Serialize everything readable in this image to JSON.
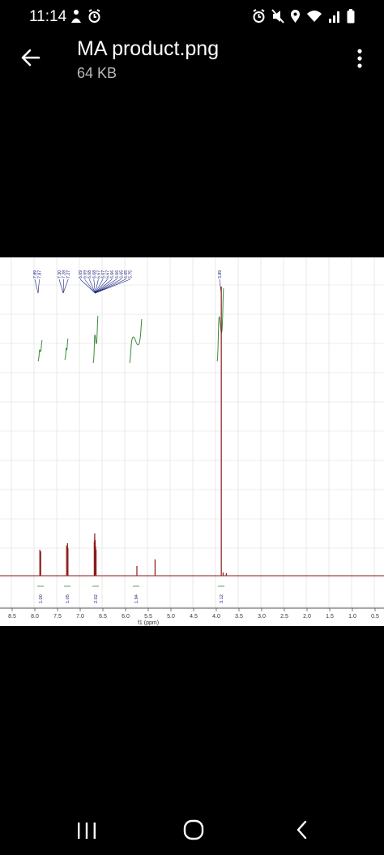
{
  "status_bar": {
    "time": "11:14",
    "left_icons": [
      "person-notification-icon",
      "alarm-icon"
    ],
    "right_icons": [
      "alarm-icon",
      "mute-icon",
      "location-icon",
      "wifi-icon",
      "signal-icon",
      "battery-icon"
    ]
  },
  "app_bar": {
    "back_icon": "arrow-back-icon",
    "file_name": "MA product.png",
    "file_size": "64 KB",
    "more_icon": "more-vert-icon"
  },
  "image": {
    "type": "1H NMR spectrum",
    "x_axis_label": "f1 (ppm)",
    "x_ticks": [
      "8.5",
      "8.0",
      "7.5",
      "7.0",
      "6.5",
      "6.0",
      "5.5",
      "5.0",
      "4.5",
      "4.0",
      "3.5",
      "3.0",
      "2.5",
      "2.0",
      "1.5",
      "1.0",
      "0.5"
    ],
    "peak_groups": [
      [
        "7.89",
        "7.87"
      ],
      [
        "7.30",
        "7.28",
        "7.27"
      ],
      [
        "6.69",
        "6.69",
        "6.68",
        "6.68",
        "6.67",
        "6.67",
        "6.67",
        "6.66",
        "6.66",
        "6.65",
        "6.65",
        "5.75"
      ],
      [
        "3.89"
      ]
    ],
    "integrals": [
      "1.00",
      "1.05",
      "2.02",
      "1.94",
      "3.12"
    ],
    "colors": {
      "spectrum": "#8b1a1a",
      "integral": "#3a8a3a",
      "peak_label": "#1a237e",
      "grid": "#dcdcdc"
    }
  },
  "nav_bar": {
    "items": [
      "recent-apps-button",
      "home-button",
      "back-button"
    ]
  }
}
